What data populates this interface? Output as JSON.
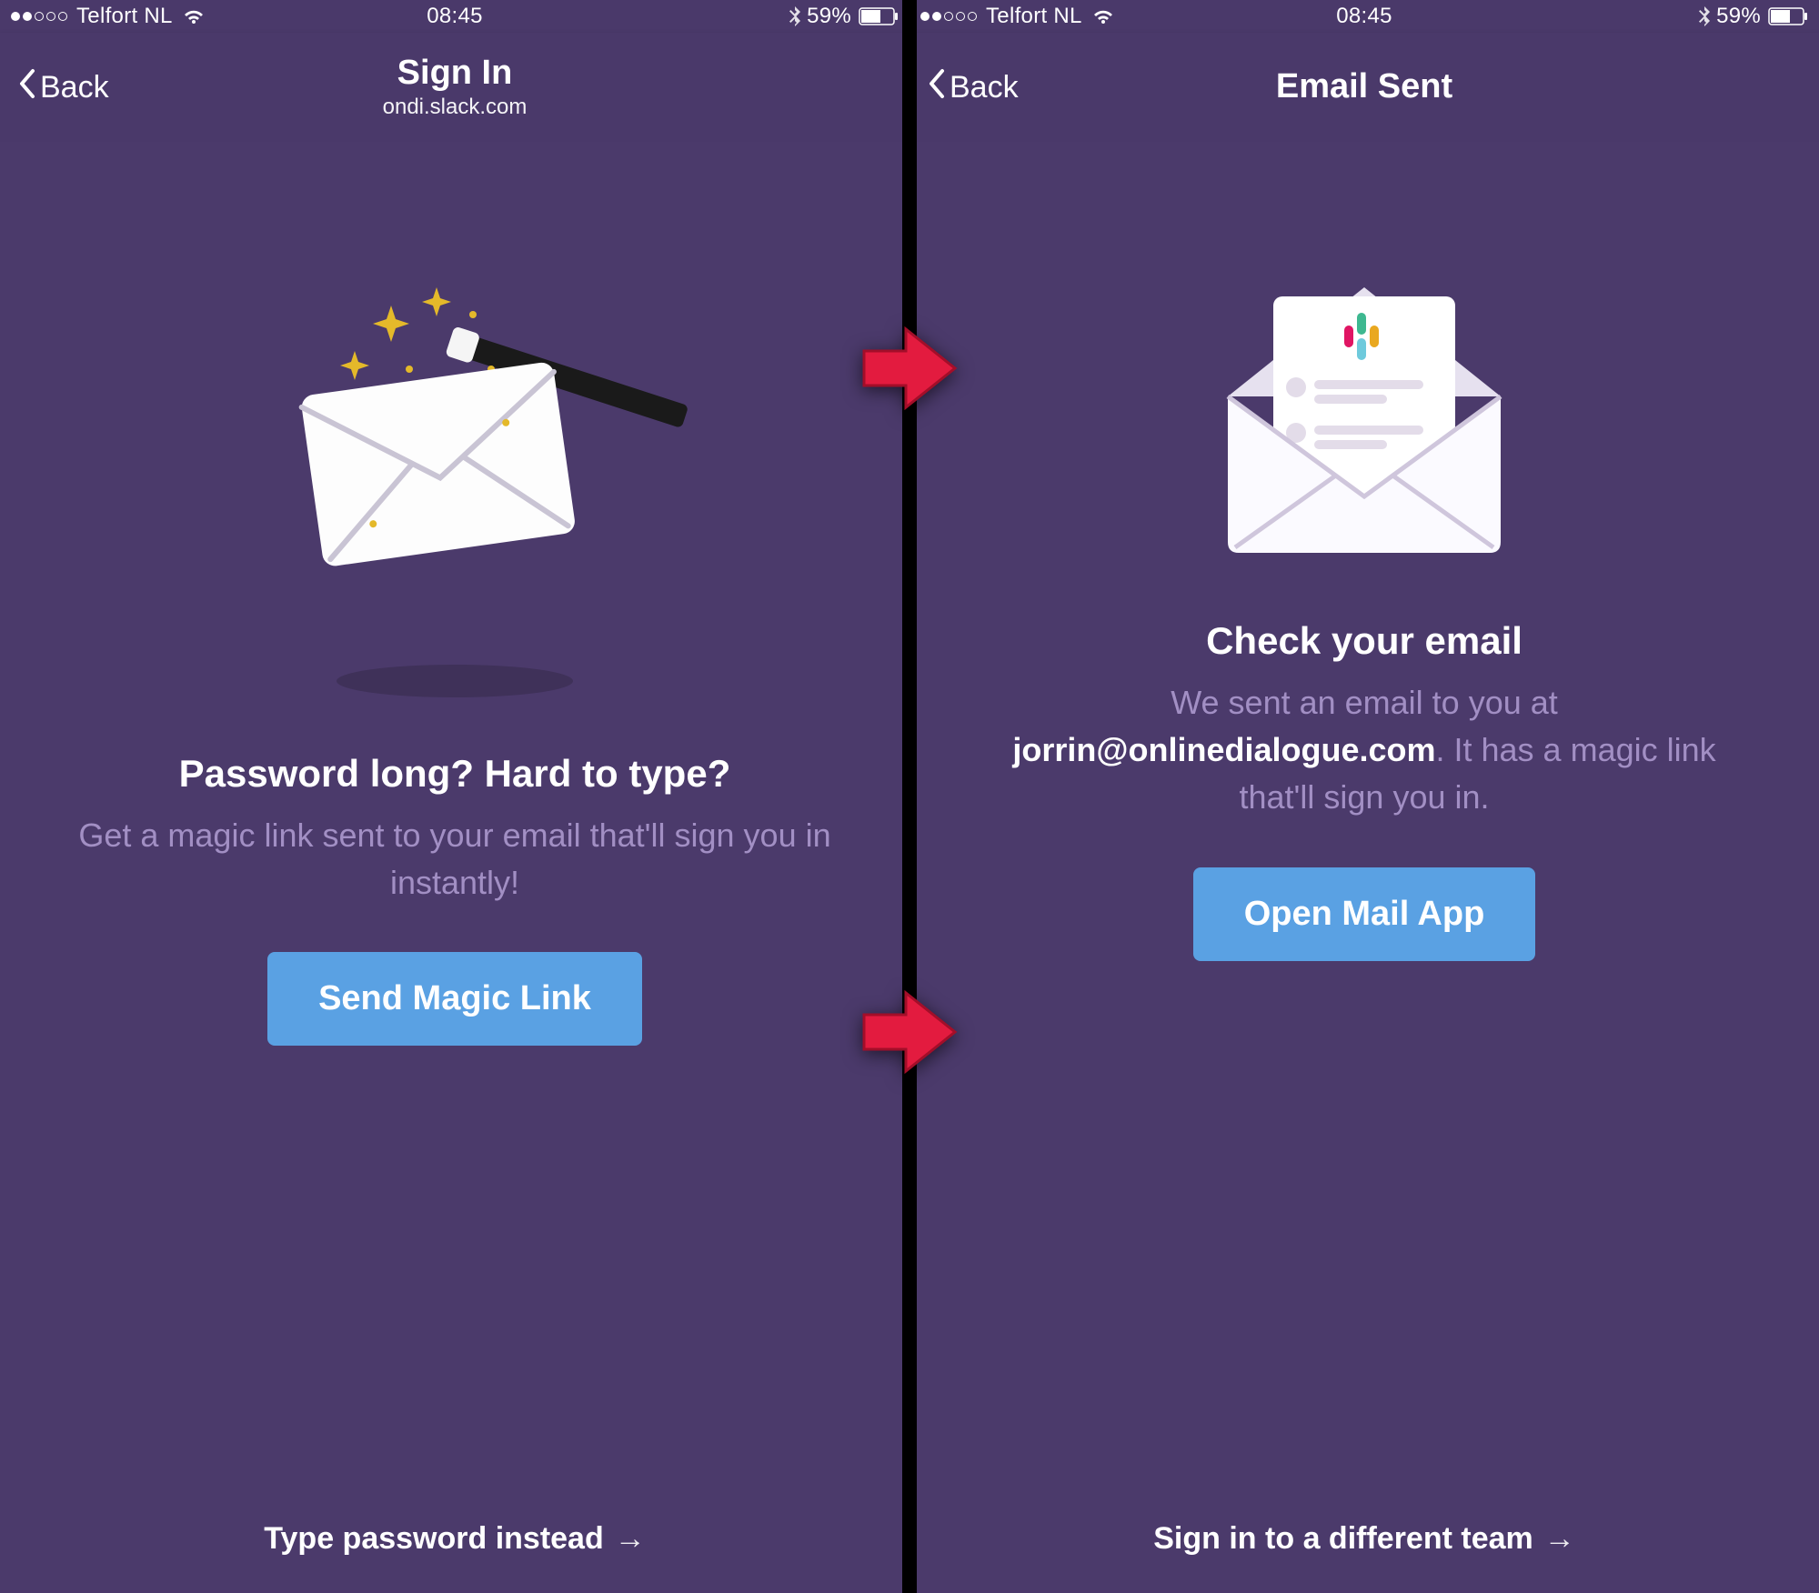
{
  "statusbar": {
    "carrier": "Telfort NL",
    "time": "08:45",
    "battery_pct": "59%"
  },
  "left": {
    "nav": {
      "back": "Back",
      "title": "Sign In",
      "subtitle": "ondi.slack.com"
    },
    "headline": "Password long? Hard to type?",
    "subtext": "Get a magic link sent to your email that'll sign you in instantly!",
    "cta": "Send Magic Link",
    "footer": "Type password instead"
  },
  "right": {
    "nav": {
      "back": "Back",
      "title": "Email Sent"
    },
    "headline": "Check your email",
    "subtext_pre": "We sent an email to you at ",
    "subtext_email": "jorrin@onlinedialogue.com",
    "subtext_post": ". It has a magic link that'll sign you in.",
    "cta": "Open Mail App",
    "footer": "Sign in to a different team"
  }
}
